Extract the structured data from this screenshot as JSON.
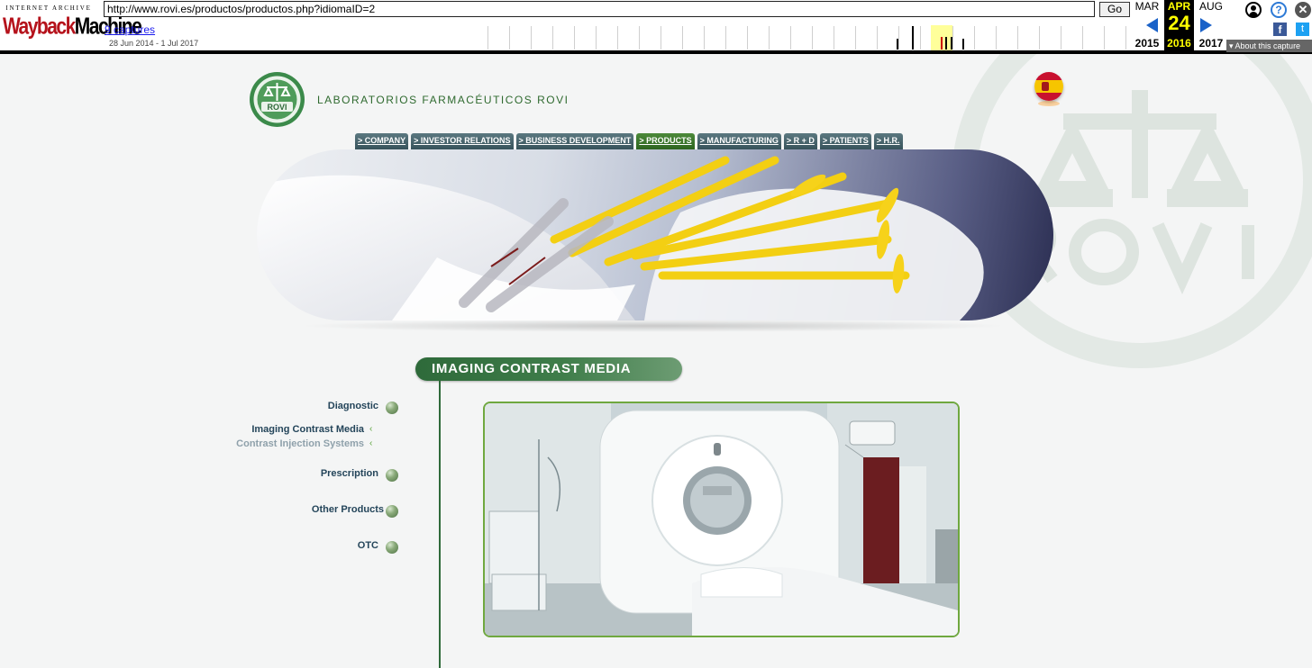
{
  "wayback": {
    "logo_top": "INTERNET ARCHIVE",
    "logo_word_red": "Wayback",
    "logo_word_black": "Machine",
    "url": "http://www.rovi.es/productos/productos.php?idiomaID=2",
    "go_label": "Go",
    "captures_label": "9 captures",
    "date_range": "28 Jun 2014 - 1 Jul 2017",
    "prev_month": "MAR",
    "prev_year": "2015",
    "current_month": "APR",
    "current_day": "24",
    "current_year": "2016",
    "next_month": "AUG",
    "next_year": "2017",
    "about_label": "▾ About this capture",
    "help_glyph": "?",
    "close_glyph": "✕",
    "facebook_glyph": "f",
    "twitter_glyph": "t"
  },
  "site": {
    "title": "LABORATORIOS FARMACÉUTICOS ROVI",
    "logo_text": "ROVI",
    "language_flag": "spain-flag-icon"
  },
  "nav": {
    "tabs": [
      {
        "label": "> COMPANY"
      },
      {
        "label": "> INVESTOR RELATIONS"
      },
      {
        "label": "> BUSINESS DEVELOPMENT"
      },
      {
        "label": "> PRODUCTS",
        "active": true
      },
      {
        "label": "> MANUFACTURING"
      },
      {
        "label": "> R + D"
      },
      {
        "label": "> PATIENTS"
      },
      {
        "label": "> H.R."
      }
    ]
  },
  "section": {
    "title": "IMAGING CONTRAST MEDIA"
  },
  "menu": {
    "diagnostic": "Diagnostic",
    "imaging_contrast_media": "Imaging Contrast Media",
    "contrast_injection_systems": "Contrast Injection Systems",
    "prescription": "Prescription",
    "other_products": "Other Products",
    "otc": "OTC",
    "sub_arrow": "‹"
  },
  "colors": {
    "accent_green": "#2f6a3a",
    "nav_active": "#3f7d2e",
    "menu_text": "#24455a",
    "sub_inactive": "#8fa1ab"
  }
}
